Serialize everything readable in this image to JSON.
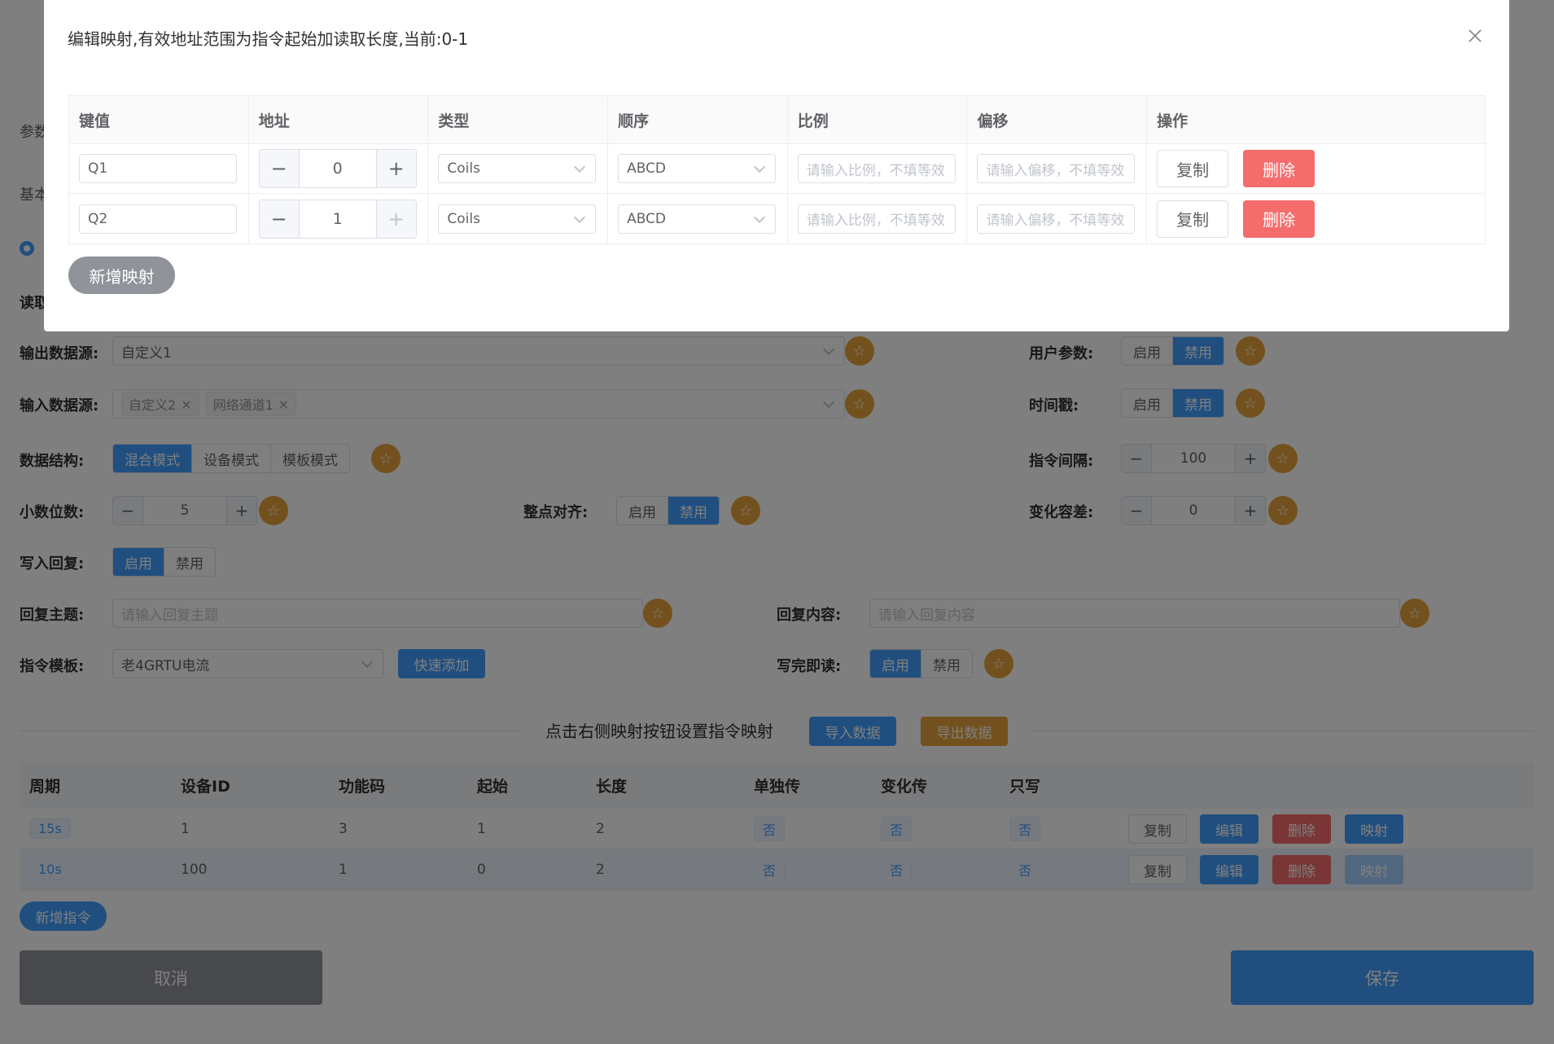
{
  "background": {
    "peek_left_1": "参数",
    "peek_left_2": "基本",
    "peek_left_3": "读取",
    "labels": {
      "output_source": "输出数据源:",
      "input_source": "输入数据源:",
      "data_structure": "数据结构:",
      "decimal_places": "小数位数:",
      "whole_point_align": "整点对齐:",
      "write_reply": "写入回复:",
      "reply_topic": "回复主题:",
      "reply_content": "回复内容:",
      "command_template": "指令模板:",
      "read_after_write": "写完即读:",
      "user_params": "用户参数:",
      "timestamp": "时间戳:",
      "command_interval": "指令间隔:",
      "change_tolerance": "变化容差:"
    },
    "output_source_value": "自定义1",
    "input_source_tags": [
      "自定义2",
      "网络通道1"
    ],
    "data_structure_options": [
      "混合模式",
      "设备模式",
      "模板模式"
    ],
    "data_structure_selected": "混合模式",
    "enable": "启用",
    "disable": "禁用",
    "decimal_places_value": "5",
    "command_interval_value": "100",
    "change_tolerance_value": "0",
    "reply_topic_placeholder": "请输入回复主题",
    "reply_content_placeholder": "请输入回复内容",
    "command_template_value": "老4GRTU电流",
    "quick_add": "快速添加",
    "mapping_hint": "点击右侧映射按钮设置指令映射",
    "import_data": "导入数据",
    "export_data": "导出数据",
    "table_headers": [
      "周期",
      "设备ID",
      "功能码",
      "起始",
      "长度",
      "单独传",
      "变化传",
      "只写"
    ],
    "rows": [
      {
        "period": "15s",
        "device_id": "1",
        "func": "3",
        "start": "1",
        "length": "2",
        "single": "否",
        "change": "否",
        "write_only": "否"
      },
      {
        "period": "10s",
        "device_id": "100",
        "func": "1",
        "start": "0",
        "length": "2",
        "single": "否",
        "change": "否",
        "write_only": "否"
      }
    ],
    "row_actions": {
      "copy": "复制",
      "edit": "编辑",
      "delete": "删除",
      "map": "映射"
    },
    "add_command": "新增指令",
    "cancel": "取消",
    "save": "保存"
  },
  "dialog": {
    "title": "编辑映射,有效地址范围为指令起始加读取长度,当前:0-1",
    "headers": [
      "键值",
      "地址",
      "类型",
      "顺序",
      "比例",
      "偏移",
      "操作"
    ],
    "rows": [
      {
        "key": "Q1",
        "address": "0",
        "type": "Coils",
        "order": "ABCD"
      },
      {
        "key": "Q2",
        "address": "1",
        "type": "Coils",
        "order": "ABCD"
      }
    ],
    "scale_placeholder": "请输入比例，不填等效",
    "offset_placeholder": "请输入偏移，不填等效",
    "copy": "复制",
    "delete": "删除",
    "add_mapping": "新增映射"
  }
}
